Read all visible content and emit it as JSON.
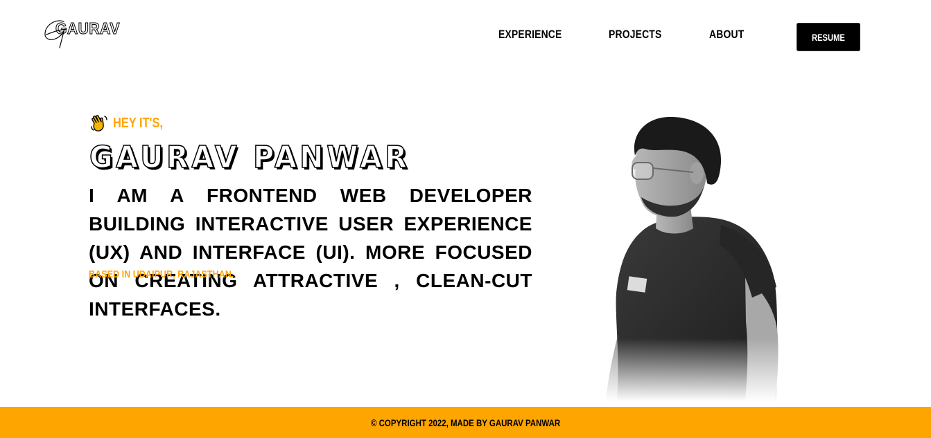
{
  "header": {
    "logo_text": "GAURAV",
    "nav": [
      {
        "label": "EXPERIENCE"
      },
      {
        "label": "PROJECTS"
      },
      {
        "label": "ABOUT"
      }
    ],
    "resume_label": "RESUME"
  },
  "hero": {
    "greeting_icon": "waving-hand-icon",
    "greeting": "HEY IT'S,",
    "name": "GAURAV PANWAR",
    "intro": "I AM A FRONTEND WEB DEVELOPER BUILDING INTERACTIVE USER EXPERIENCE (UX) AND INTERFACE (UI). MORE FOCUSED ON CREATING ATTRACTIVE , CLEAN-CUT INTERFACES.",
    "location": "BASED IN UDAIPUR, RAJASTHAN."
  },
  "footer": {
    "copyright": "© COPYRIGHT 2022, MADE BY GAURAV PANWAR"
  },
  "colors": {
    "accent": "#ffa500",
    "text": "#000000",
    "background": "#ffffff"
  }
}
